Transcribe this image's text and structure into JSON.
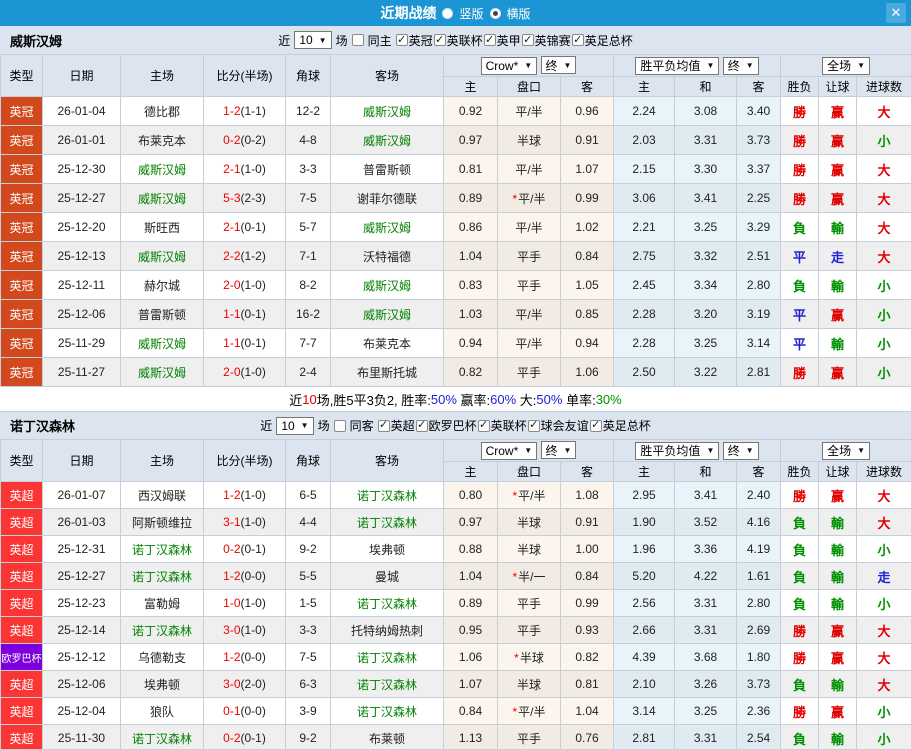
{
  "colors": {
    "titlebar": "#1b95d3",
    "red": "#e10000",
    "green": "#009100",
    "blue": "#2020d5",
    "team_highlight": "#008000",
    "badges": {
      "英冠": "#d2491d",
      "英超": "#fb3434",
      "欧罗巴杯": "#7d00dc"
    }
  },
  "titlebar": {
    "title": "近期战绩",
    "vertical": "竖版",
    "horizontal": "横版",
    "close": "✕"
  },
  "table": {
    "cols": [
      "类型",
      "日期",
      "主场",
      "比分(半场)",
      "角球",
      "客场"
    ],
    "sub_cols": [
      "主",
      "盘口",
      "客",
      "主",
      "和",
      "客",
      "胜负",
      "让球",
      "进球数"
    ],
    "selects": {
      "odds": "Crow*",
      "fin": "终",
      "avg": "胜平负均值",
      "fin2": "终",
      "scope": "全场"
    }
  },
  "sections": [
    {
      "team": "威斯汉姆",
      "filter": {
        "near": "近",
        "count": "10",
        "unit": "场",
        "same": "同主",
        "same_checked": false,
        "leagues": [
          "英冠",
          "英联杯",
          "英甲",
          "英锦赛",
          "英足总杯"
        ]
      },
      "rows": [
        {
          "league": "英冠",
          "date": "26-01-04",
          "home": "德比郡",
          "home_hl": false,
          "ft": "1-2",
          "ht": "(1-1)",
          "corners": "12-2",
          "away": "威斯汉姆",
          "away_hl": true,
          "crow_home": "0.92",
          "handicap": "平/半",
          "star": false,
          "crow_away": "0.96",
          "avg_home": "2.24",
          "avg_draw": "3.08",
          "avg_away": "3.40",
          "result": [
            "勝",
            "r"
          ],
          "let": [
            "赢",
            "r"
          ],
          "goals": [
            "大",
            "r"
          ]
        },
        {
          "league": "英冠",
          "date": "26-01-01",
          "home": "布莱克本",
          "home_hl": false,
          "ft": "0-2",
          "ht": "(0-2)",
          "corners": "4-8",
          "away": "威斯汉姆",
          "away_hl": true,
          "crow_home": "0.97",
          "handicap": "半球",
          "star": false,
          "crow_away": "0.91",
          "avg_home": "2.03",
          "avg_draw": "3.31",
          "avg_away": "3.73",
          "result": [
            "勝",
            "r"
          ],
          "let": [
            "赢",
            "r"
          ],
          "goals": [
            "小",
            "g"
          ]
        },
        {
          "league": "英冠",
          "date": "25-12-30",
          "home": "威斯汉姆",
          "home_hl": true,
          "ft": "2-1",
          "ht": "(1-0)",
          "corners": "3-3",
          "away": "普雷斯顿",
          "away_hl": false,
          "crow_home": "0.81",
          "handicap": "平/半",
          "star": false,
          "crow_away": "1.07",
          "avg_home": "2.15",
          "avg_draw": "3.30",
          "avg_away": "3.37",
          "result": [
            "勝",
            "r"
          ],
          "let": [
            "赢",
            "r"
          ],
          "goals": [
            "大",
            "r"
          ]
        },
        {
          "league": "英冠",
          "date": "25-12-27",
          "home": "威斯汉姆",
          "home_hl": true,
          "ft": "5-3",
          "ht": "(2-3)",
          "corners": "7-5",
          "away": "谢菲尔德联",
          "away_hl": false,
          "crow_home": "0.89",
          "handicap": "平/半",
          "star": true,
          "crow_away": "0.99",
          "avg_home": "3.06",
          "avg_draw": "3.41",
          "avg_away": "2.25",
          "result": [
            "勝",
            "r"
          ],
          "let": [
            "赢",
            "r"
          ],
          "goals": [
            "大",
            "r"
          ]
        },
        {
          "league": "英冠",
          "date": "25-12-20",
          "home": "斯旺西",
          "home_hl": false,
          "ft": "2-1",
          "ht": "(0-1)",
          "corners": "5-7",
          "away": "威斯汉姆",
          "away_hl": true,
          "crow_home": "0.86",
          "handicap": "平/半",
          "star": false,
          "crow_away": "1.02",
          "avg_home": "2.21",
          "avg_draw": "3.25",
          "avg_away": "3.29",
          "result": [
            "負",
            "g"
          ],
          "let": [
            "輸",
            "g"
          ],
          "goals": [
            "大",
            "r"
          ]
        },
        {
          "league": "英冠",
          "date": "25-12-13",
          "home": "威斯汉姆",
          "home_hl": true,
          "ft": "2-2",
          "ht": "(1-2)",
          "corners": "7-1",
          "away": "沃特福德",
          "away_hl": false,
          "crow_home": "1.04",
          "handicap": "平手",
          "star": false,
          "crow_away": "0.84",
          "avg_home": "2.75",
          "avg_draw": "3.32",
          "avg_away": "2.51",
          "result": [
            "平",
            "b"
          ],
          "let": [
            "走",
            "b"
          ],
          "goals": [
            "大",
            "r"
          ]
        },
        {
          "league": "英冠",
          "date": "25-12-11",
          "home": "赫尔城",
          "home_hl": false,
          "ft": "2-0",
          "ht": "(1-0)",
          "corners": "8-2",
          "away": "威斯汉姆",
          "away_hl": true,
          "crow_home": "0.83",
          "handicap": "平手",
          "star": false,
          "crow_away": "1.05",
          "avg_home": "2.45",
          "avg_draw": "3.34",
          "avg_away": "2.80",
          "result": [
            "負",
            "g"
          ],
          "let": [
            "輸",
            "g"
          ],
          "goals": [
            "小",
            "g"
          ]
        },
        {
          "league": "英冠",
          "date": "25-12-06",
          "home": "普雷斯顿",
          "home_hl": false,
          "ft": "1-1",
          "ht": "(0-1)",
          "corners": "16-2",
          "away": "威斯汉姆",
          "away_hl": true,
          "crow_home": "1.03",
          "handicap": "平/半",
          "star": false,
          "crow_away": "0.85",
          "avg_home": "2.28",
          "avg_draw": "3.20",
          "avg_away": "3.19",
          "result": [
            "平",
            "b"
          ],
          "let": [
            "赢",
            "r"
          ],
          "goals": [
            "小",
            "g"
          ]
        },
        {
          "league": "英冠",
          "date": "25-11-29",
          "home": "威斯汉姆",
          "home_hl": true,
          "ft": "1-1",
          "ht": "(0-1)",
          "corners": "7-7",
          "away": "布莱克本",
          "away_hl": false,
          "crow_home": "0.94",
          "handicap": "平/半",
          "star": false,
          "crow_away": "0.94",
          "avg_home": "2.28",
          "avg_draw": "3.25",
          "avg_away": "3.14",
          "result": [
            "平",
            "b"
          ],
          "let": [
            "輸",
            "g"
          ],
          "goals": [
            "小",
            "g"
          ]
        },
        {
          "league": "英冠",
          "date": "25-11-27",
          "home": "威斯汉姆",
          "home_hl": true,
          "ft": "2-0",
          "ht": "(1-0)",
          "corners": "2-4",
          "away": "布里斯托城",
          "away_hl": false,
          "crow_home": "0.82",
          "handicap": "平手",
          "star": false,
          "crow_away": "1.06",
          "avg_home": "2.50",
          "avg_draw": "3.22",
          "avg_away": "2.81",
          "result": [
            "勝",
            "r"
          ],
          "let": [
            "赢",
            "r"
          ],
          "goals": [
            "小",
            "g"
          ]
        }
      ],
      "summary": [
        [
          "近",
          "k"
        ],
        [
          "10",
          "r"
        ],
        [
          "场,胜5平3负2, 胜率:",
          "k"
        ],
        [
          "50%",
          "b"
        ],
        [
          " 赢率:",
          "k"
        ],
        [
          "60%",
          "b"
        ],
        [
          " 大:",
          "k"
        ],
        [
          "50%",
          "b"
        ],
        [
          " 单率:",
          "k"
        ],
        [
          "30%",
          "g"
        ]
      ]
    },
    {
      "team": "诺丁汉森林",
      "filter": {
        "near": "近",
        "count": "10",
        "unit": "场",
        "same": "同客",
        "same_checked": false,
        "leagues": [
          "英超",
          "欧罗巴杯",
          "英联杯",
          "球会友谊",
          "英足总杯"
        ]
      },
      "rows": [
        {
          "league": "英超",
          "date": "26-01-07",
          "home": "西汉姆联",
          "home_hl": false,
          "ft": "1-2",
          "ht": "(1-0)",
          "corners": "6-5",
          "away": "诺丁汉森林",
          "away_hl": true,
          "crow_home": "0.80",
          "handicap": "平/半",
          "star": true,
          "crow_away": "1.08",
          "avg_home": "2.95",
          "avg_draw": "3.41",
          "avg_away": "2.40",
          "result": [
            "勝",
            "r"
          ],
          "let": [
            "赢",
            "r"
          ],
          "goals": [
            "大",
            "r"
          ]
        },
        {
          "league": "英超",
          "date": "26-01-03",
          "home": "阿斯顿维拉",
          "home_hl": false,
          "ft": "3-1",
          "ht": "(1-0)",
          "corners": "4-4",
          "away": "诺丁汉森林",
          "away_hl": true,
          "crow_home": "0.97",
          "handicap": "半球",
          "star": false,
          "crow_away": "0.91",
          "avg_home": "1.90",
          "avg_draw": "3.52",
          "avg_away": "4.16",
          "result": [
            "負",
            "g"
          ],
          "let": [
            "輸",
            "g"
          ],
          "goals": [
            "大",
            "r"
          ]
        },
        {
          "league": "英超",
          "date": "25-12-31",
          "home": "诺丁汉森林",
          "home_hl": true,
          "ft": "0-2",
          "ht": "(0-1)",
          "corners": "9-2",
          "away": "埃弗顿",
          "away_hl": false,
          "crow_home": "0.88",
          "handicap": "半球",
          "star": false,
          "crow_away": "1.00",
          "avg_home": "1.96",
          "avg_draw": "3.36",
          "avg_away": "4.19",
          "result": [
            "負",
            "g"
          ],
          "let": [
            "輸",
            "g"
          ],
          "goals": [
            "小",
            "g"
          ]
        },
        {
          "league": "英超",
          "date": "25-12-27",
          "home": "诺丁汉森林",
          "home_hl": true,
          "ft": "1-2",
          "ht": "(0-0)",
          "corners": "5-5",
          "away": "曼城",
          "away_hl": false,
          "crow_home": "1.04",
          "handicap": "半/一",
          "star": true,
          "crow_away": "0.84",
          "avg_home": "5.20",
          "avg_draw": "4.22",
          "avg_away": "1.61",
          "result": [
            "負",
            "g"
          ],
          "let": [
            "輸",
            "g"
          ],
          "goals": [
            "走",
            "b"
          ]
        },
        {
          "league": "英超",
          "date": "25-12-23",
          "home": "富勒姆",
          "home_hl": false,
          "ft": "1-0",
          "ht": "(1-0)",
          "corners": "1-5",
          "away": "诺丁汉森林",
          "away_hl": true,
          "crow_home": "0.89",
          "handicap": "平手",
          "star": false,
          "crow_away": "0.99",
          "avg_home": "2.56",
          "avg_draw": "3.31",
          "avg_away": "2.80",
          "result": [
            "負",
            "g"
          ],
          "let": [
            "輸",
            "g"
          ],
          "goals": [
            "小",
            "g"
          ]
        },
        {
          "league": "英超",
          "date": "25-12-14",
          "home": "诺丁汉森林",
          "home_hl": true,
          "ft": "3-0",
          "ht": "(1-0)",
          "corners": "3-3",
          "away": "托特纳姆热刺",
          "away_hl": false,
          "crow_home": "0.95",
          "handicap": "平手",
          "star": false,
          "crow_away": "0.93",
          "avg_home": "2.66",
          "avg_draw": "3.31",
          "avg_away": "2.69",
          "result": [
            "勝",
            "r"
          ],
          "let": [
            "赢",
            "r"
          ],
          "goals": [
            "大",
            "r"
          ]
        },
        {
          "league": "欧罗巴杯",
          "date": "25-12-12",
          "home": "乌德勒支",
          "home_hl": false,
          "ft": "1-2",
          "ht": "(0-0)",
          "corners": "7-5",
          "away": "诺丁汉森林",
          "away_hl": true,
          "crow_home": "1.06",
          "handicap": "半球",
          "star": true,
          "crow_away": "0.82",
          "avg_home": "4.39",
          "avg_draw": "3.68",
          "avg_away": "1.80",
          "result": [
            "勝",
            "r"
          ],
          "let": [
            "赢",
            "r"
          ],
          "goals": [
            "大",
            "r"
          ]
        },
        {
          "league": "英超",
          "date": "25-12-06",
          "home": "埃弗顿",
          "home_hl": false,
          "ft": "3-0",
          "ht": "(2-0)",
          "corners": "6-3",
          "away": "诺丁汉森林",
          "away_hl": true,
          "crow_home": "1.07",
          "handicap": "半球",
          "star": false,
          "crow_away": "0.81",
          "avg_home": "2.10",
          "avg_draw": "3.26",
          "avg_away": "3.73",
          "result": [
            "負",
            "g"
          ],
          "let": [
            "輸",
            "g"
          ],
          "goals": [
            "大",
            "r"
          ]
        },
        {
          "league": "英超",
          "date": "25-12-04",
          "home": "狼队",
          "home_hl": false,
          "ft": "0-1",
          "ht": "(0-0)",
          "corners": "3-9",
          "away": "诺丁汉森林",
          "away_hl": true,
          "crow_home": "0.84",
          "handicap": "平/半",
          "star": true,
          "crow_away": "1.04",
          "avg_home": "3.14",
          "avg_draw": "3.25",
          "avg_away": "2.36",
          "result": [
            "勝",
            "r"
          ],
          "let": [
            "赢",
            "r"
          ],
          "goals": [
            "小",
            "g"
          ]
        },
        {
          "league": "英超",
          "date": "25-11-30",
          "home": "诺丁汉森林",
          "home_hl": true,
          "ft": "0-2",
          "ht": "(0-1)",
          "corners": "9-2",
          "away": "布莱顿",
          "away_hl": false,
          "crow_home": "1.13",
          "handicap": "平手",
          "star": false,
          "crow_away": "0.76",
          "avg_home": "2.81",
          "avg_draw": "3.31",
          "avg_away": "2.54",
          "result": [
            "負",
            "g"
          ],
          "let": [
            "輸",
            "g"
          ],
          "goals": [
            "小",
            "g"
          ]
        }
      ]
    }
  ]
}
